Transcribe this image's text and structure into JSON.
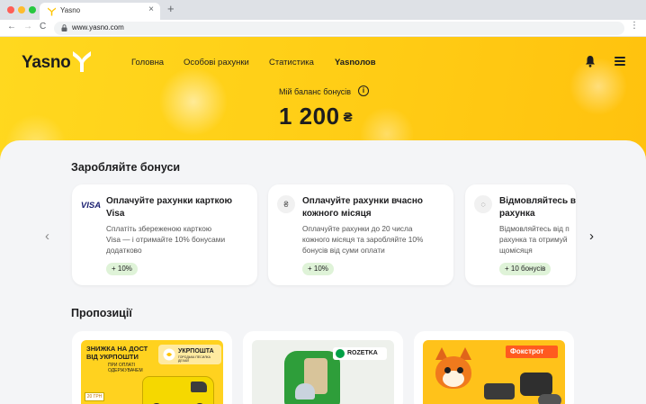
{
  "browser": {
    "tab_title": "Yasno",
    "tab_close": "×",
    "new_tab": "+",
    "url": "www.yasno.com",
    "back": "←",
    "forward": "→",
    "reload": "C",
    "menu": "⋮"
  },
  "header": {
    "logo": "Yasno",
    "nav": [
      {
        "label": "Головна",
        "active": false
      },
      {
        "label": "Особові рахунки",
        "active": false
      },
      {
        "label": "Статистика",
        "active": false
      },
      {
        "label": "Yasnoлов",
        "active": true
      }
    ],
    "icons": {
      "notifications": "bell-icon",
      "menu": "hamburger-icon"
    },
    "balance_label": "Мій баланс бонусів",
    "info_icon": "i",
    "balance_value": "1 200",
    "currency": "₴"
  },
  "earn": {
    "title": "Заробляйте бонуси",
    "prev_arrow": "‹",
    "next_arrow": "›",
    "cards": [
      {
        "icon": "visa-icon",
        "icon_text": "VISA",
        "title": "Оплачуйте рахунки карткою\nVisa",
        "text": "Сплатіть збереженою карткою\nVisa — і отримайте 10% бонусами\nдодатково",
        "badge": "+ 10%"
      },
      {
        "icon": "payment-hand-icon",
        "icon_text": "₴",
        "title": "Оплачуйте рахунки вчасно\nкожного місяця",
        "text": "Оплачуйте рахунки до 20 числа\nкожного місяця та заробляйте 10%\nбонусів від суми оплати",
        "badge": "+ 10%"
      },
      {
        "icon": "lightbulb-icon",
        "icon_text": "◌",
        "title": "Відмовляйтесь від\nрахунка",
        "text": "Відмовляйтесь від п\nрахунка та отримуй\nщомісяця",
        "badge": "+ 10 бонусів"
      }
    ]
  },
  "offers": {
    "title": "Пропозиції",
    "items": [
      {
        "name": "ukrposhta",
        "headline": "ЗНИЖКА НА ДОСТ\nВІД УКРПОШТИ",
        "subline": "ПРИ ОПЛАТІ\nОДЕРЖУВАЧЕМ",
        "brand": "УКРПОШТА",
        "brand_sub": "ГОРОДЬКА ПЕСИЛКА ДЕХАЙ",
        "coupon": "20 ГРН"
      },
      {
        "name": "rozetka",
        "brand": "ROZETKA"
      },
      {
        "name": "foxtrot",
        "brand": "Фокстрот"
      }
    ]
  },
  "colors": {
    "brand_yellow": "#ffd21f",
    "badge_green": "#dff3d8",
    "panel_bg": "#f4f5f7"
  }
}
